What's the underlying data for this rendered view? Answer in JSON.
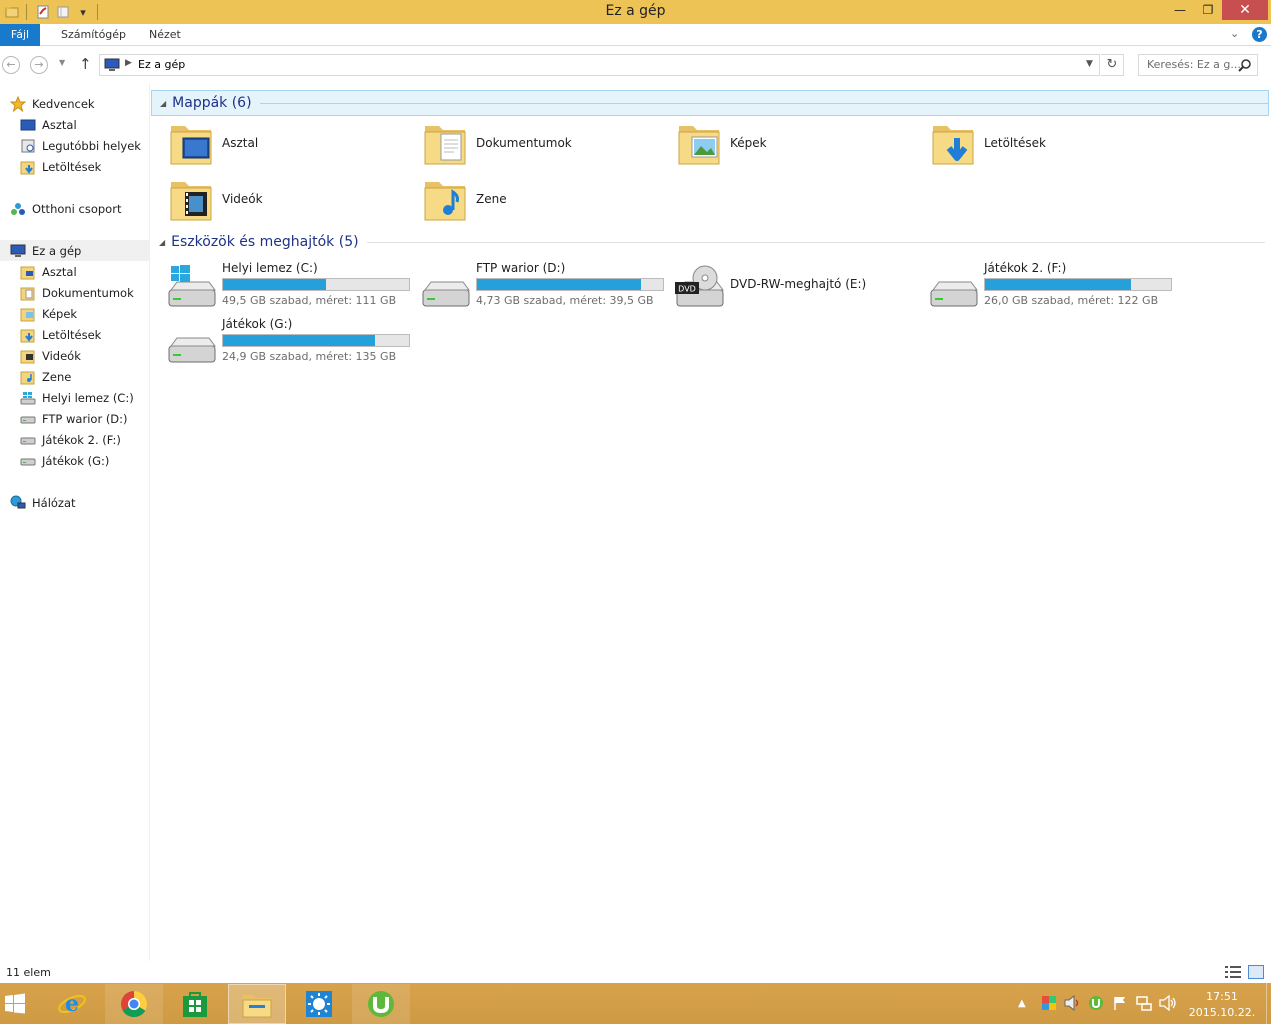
{
  "window": {
    "title": "Ez a gép",
    "minimize_glyph": "—",
    "maximize_glyph": "❐",
    "close_glyph": "✕"
  },
  "ribbon": {
    "tabs": [
      "Fájl",
      "Számítógép",
      "Nézet"
    ],
    "help_glyph": "?"
  },
  "address": {
    "crumbs": [
      "Ez a gép"
    ],
    "search_placeholder": "Keresés: Ez a g..."
  },
  "nav": {
    "favorites": {
      "label": "Kedvencek",
      "items": [
        "Asztal",
        "Legutóbbi helyek",
        "Letöltések"
      ]
    },
    "homegroup": "Otthoni csoport",
    "thispc": {
      "label": "Ez a gép",
      "items": [
        "Asztal",
        "Dokumentumok",
        "Képek",
        "Letöltések",
        "Videók",
        "Zene",
        "Helyi lemez (C:)",
        "FTP warior (D:)",
        "Játékok 2. (F:)",
        "Játékok (G:)"
      ]
    },
    "network": "Hálózat"
  },
  "folders_group": {
    "title": "Mappák (6)",
    "items": [
      {
        "name": "Asztal",
        "icon": "desktop-folder-icon"
      },
      {
        "name": "Dokumentumok",
        "icon": "documents-folder-icon"
      },
      {
        "name": "Képek",
        "icon": "pictures-folder-icon"
      },
      {
        "name": "Letöltések",
        "icon": "downloads-folder-icon"
      },
      {
        "name": "Videók",
        "icon": "videos-folder-icon"
      },
      {
        "name": "Zene",
        "icon": "music-folder-icon"
      }
    ]
  },
  "drives_group": {
    "title": "Eszközök és meghajtók (5)",
    "items": [
      {
        "name": "Helyi lemez (C:)",
        "size_text": "49,5 GB szabad, méret: 111 GB",
        "used_fraction": 0.554,
        "icon": "system-drive-icon"
      },
      {
        "name": "FTP warior (D:)",
        "size_text": "4,73 GB szabad, méret: 39,5 GB",
        "used_fraction": 0.88,
        "icon": "hard-drive-icon"
      },
      {
        "name": "DVD-RW-meghajtó (E:)",
        "size_text": "",
        "icon": "dvd-drive-icon",
        "dvd_label": "DVD"
      },
      {
        "name": "Játékok 2. (F:)",
        "size_text": "26,0 GB szabad, méret: 122 GB",
        "used_fraction": 0.787,
        "icon": "hard-drive-icon"
      },
      {
        "name": "Játékok (G:)",
        "size_text": "24,9 GB szabad, méret: 135 GB",
        "used_fraction": 0.816,
        "icon": "hard-drive-icon"
      }
    ]
  },
  "status": {
    "item_count": "11 elem"
  },
  "taskbar": {
    "apps": [
      "start-icon",
      "internet-explorer-icon",
      "chrome-icon",
      "store-icon",
      "file-explorer-icon",
      "weather-icon",
      "utorrent-icon"
    ],
    "time": "17:51",
    "date": "2015.10.22."
  },
  "colors": {
    "titlebar": "#eec355",
    "accent": "#1979ca",
    "drive_bar": "#26a0da",
    "group_title": "#1e3287",
    "taskbar": "#d7a24b"
  }
}
